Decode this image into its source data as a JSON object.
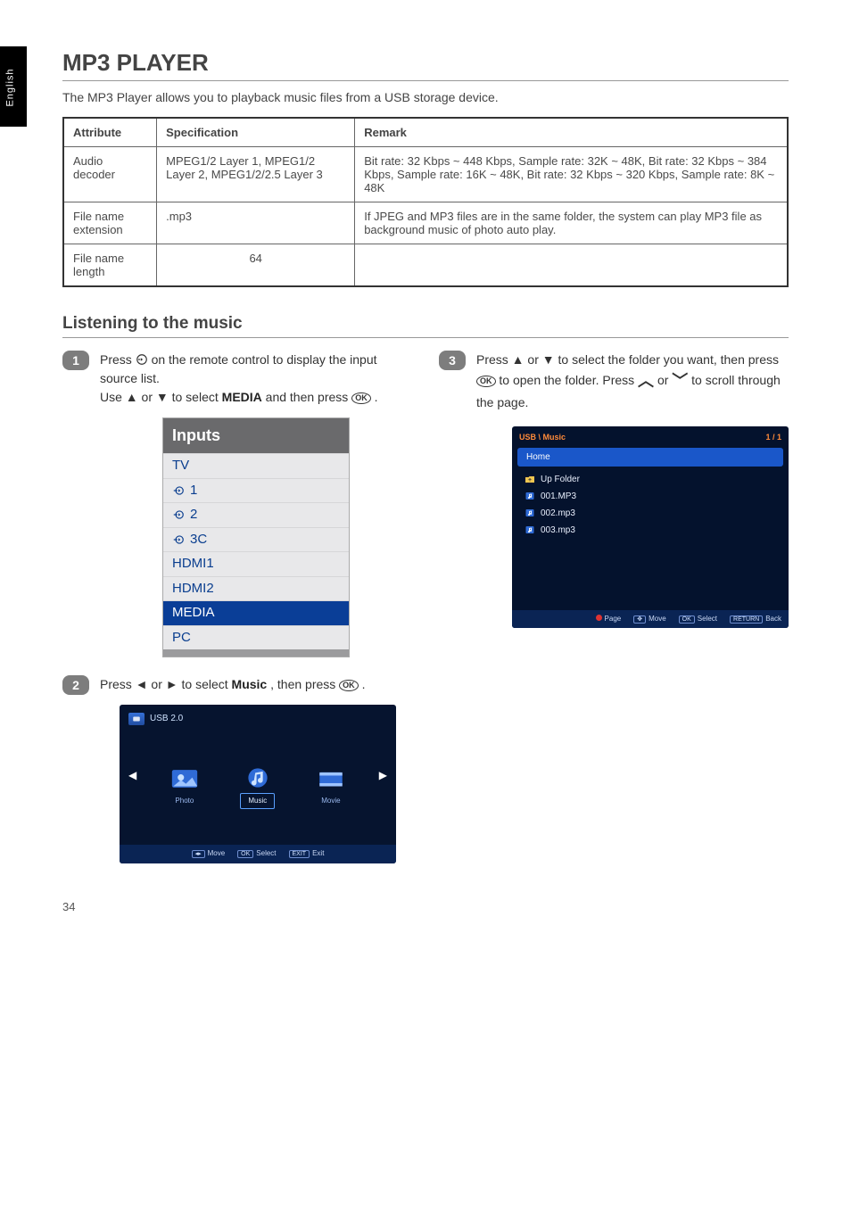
{
  "tab_label": "English",
  "title": "MP3 PLAYER",
  "intro": "The MP3 Player allows you to playback music files from a USB storage device.",
  "spec_table": {
    "headers": [
      "Attribute",
      "Specification",
      "Remark"
    ],
    "rows": [
      {
        "attr": "Audio decoder",
        "spec": "MPEG1/2 Layer 1, MPEG1/2 Layer 2, MPEG1/2/2.5 Layer 3",
        "remark": "Bit rate: 32 Kbps ~ 448 Kbps, Sample rate: 32K ~ 48K, Bit rate: 32 Kbps ~ 384 Kbps, Sample rate: 16K ~ 48K, Bit rate: 32 Kbps ~ 320 Kbps, Sample rate: 8K ~ 48K"
      },
      {
        "attr": "File name extension",
        "spec": ".mp3",
        "remark": "If JPEG and MP3 files are in the same folder, the system can play MP3 file as background music of photo auto play."
      },
      {
        "attr": "File name length",
        "spec": "64",
        "remark": ""
      }
    ]
  },
  "section_head": "Listening to the music",
  "steps": {
    "s1": {
      "num": "1",
      "line1_pre": "Press ",
      "line1_post": " on the remote control to display the input source list.",
      "line2_pre": "Use ▲ or ▼ to select ",
      "line2_bold": "MEDIA",
      "line2_mid": " and then press ",
      "line2_post": "."
    },
    "s2": {
      "num": "2",
      "pre": "Press ◄ or ► to select ",
      "bold": "Music",
      "mid": ", then press ",
      "post": "."
    },
    "s3": {
      "num": "3",
      "pre": "Press ▲ or ▼ to select the folder you want, then press ",
      "post": " to open the folder. Press ",
      "or": " or ",
      "tail": " to scroll through the page."
    }
  },
  "ok_label": "OK",
  "inputs_panel": {
    "header": "Inputs",
    "items": [
      "TV",
      "1",
      "2",
      "3C",
      "HDMI1",
      "HDMI2",
      "MEDIA",
      "PC"
    ],
    "selected_index": 6
  },
  "usb_shot": {
    "device": "USB 2.0",
    "tiles": [
      {
        "label": "Photo",
        "kind": "photo"
      },
      {
        "label": "Music",
        "kind": "music"
      },
      {
        "label": "Movie",
        "kind": "movie"
      }
    ],
    "selected_index": 1,
    "hints": [
      {
        "key": "◂▸",
        "label": "Move"
      },
      {
        "key": "OK",
        "label": "Select"
      },
      {
        "key": "EXIT",
        "label": "Exit"
      }
    ]
  },
  "music_shot": {
    "breadcrumb": "USB \\ Music",
    "page_indicator": "1 / 1",
    "selected": "Home",
    "items": [
      {
        "icon": "folder",
        "label": "Up Folder"
      },
      {
        "icon": "music",
        "label": "001.MP3"
      },
      {
        "icon": "music",
        "label": "002.mp3"
      },
      {
        "icon": "music",
        "label": "003.mp3"
      }
    ],
    "hints": [
      {
        "kind": "red",
        "label": "Page"
      },
      {
        "key": "✥",
        "label": "Move"
      },
      {
        "key": "OK",
        "label": "Select"
      },
      {
        "key": "RETURN",
        "label": "Back"
      }
    ]
  },
  "page_number": "34"
}
